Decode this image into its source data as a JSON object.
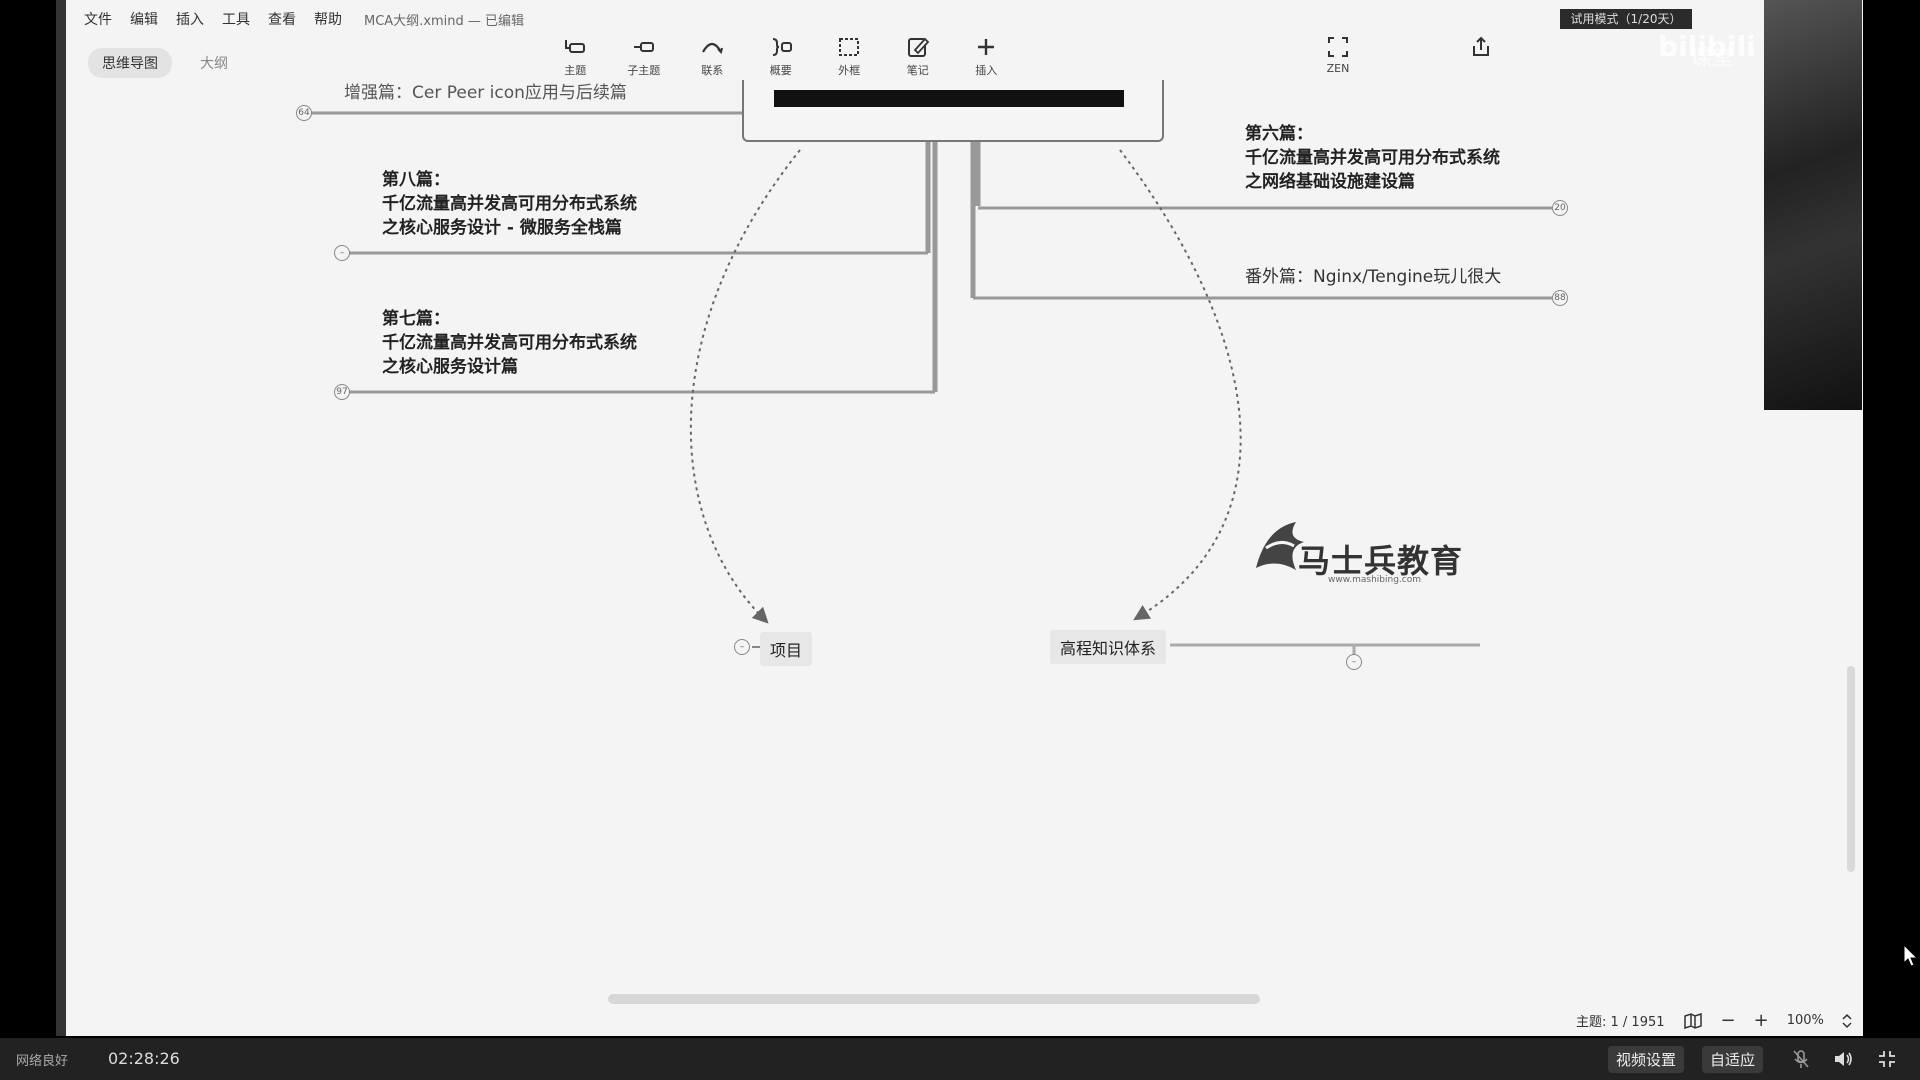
{
  "menu": {
    "items": [
      "文件",
      "编辑",
      "插入",
      "工具",
      "查看",
      "帮助"
    ],
    "file_title": "MCA大纲.xmind — 已编辑",
    "trial_badge": "试用模式（1/20天）"
  },
  "view_tabs": {
    "mindmap": "思维导图",
    "outline": "大纲"
  },
  "toolbar": {
    "topic": "主题",
    "subtopic": "子主题",
    "relationship": "联系",
    "summary": "概要",
    "boundary": "外框",
    "note": "笔记",
    "insert": "插入",
    "zen": "ZEN"
  },
  "topics": {
    "partial_top": "增强篇：Cer Peer icon应用与后续篇",
    "eighth": [
      "第八篇：",
      "千亿流量高并发高可用分布式系统",
      "之核心服务设计 - 微服务全栈篇"
    ],
    "seventh": [
      "第七篇：",
      "千亿流量高并发高可用分布式系统",
      "之核心服务设计篇"
    ],
    "sixth": [
      "第六篇：",
      "千亿流量高并发高可用分布式系统",
      "之网络基础设施建设篇"
    ],
    "extra": "番外篇：Nginx/Tengine玩儿很大",
    "project": "项目",
    "knowledge": "高程知识体系"
  },
  "badges": {
    "b64": "64",
    "b97": "97",
    "b20": "20",
    "b88": "88"
  },
  "logo": {
    "name": "马士兵教育",
    "url": "www.mashibing.com"
  },
  "status": {
    "topic_count": "主题: 1 / 1951",
    "zoom": "100%"
  },
  "player": {
    "network": "网络良好",
    "time": "02:28:26",
    "video_settings": "视频设置",
    "fit": "自适应"
  },
  "overlay": {
    "bilibili": "bilibili",
    "course": "课堂"
  }
}
